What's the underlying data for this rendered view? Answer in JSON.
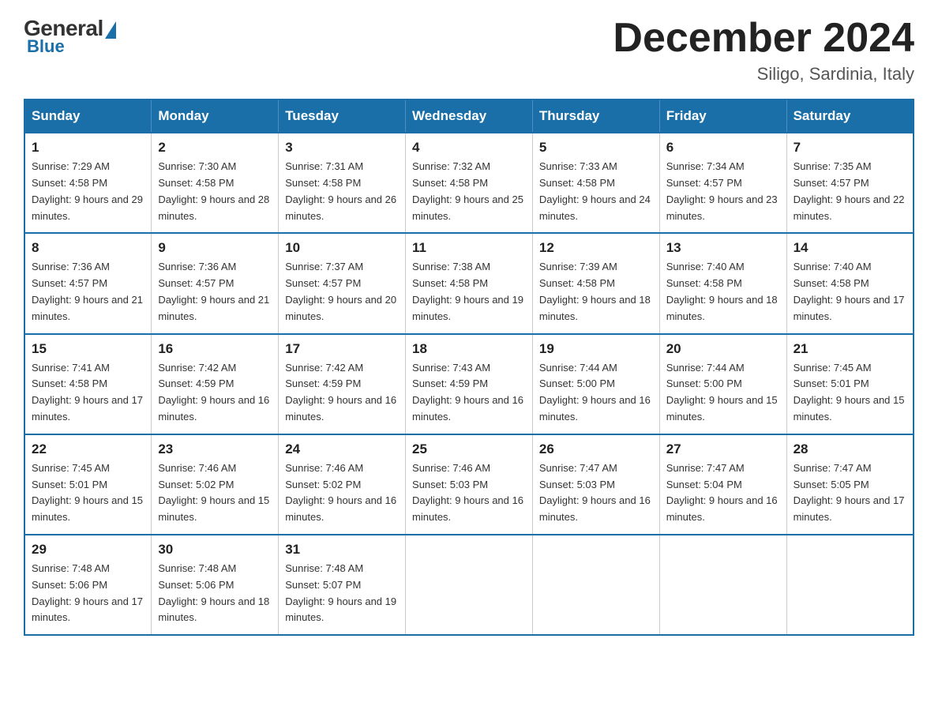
{
  "logo": {
    "general": "General",
    "blue": "Blue"
  },
  "header": {
    "month": "December 2024",
    "location": "Siligo, Sardinia, Italy"
  },
  "weekdays": [
    "Sunday",
    "Monday",
    "Tuesday",
    "Wednesday",
    "Thursday",
    "Friday",
    "Saturday"
  ],
  "weeks": [
    [
      {
        "day": "1",
        "sunrise": "7:29 AM",
        "sunset": "4:58 PM",
        "daylight": "9 hours and 29 minutes."
      },
      {
        "day": "2",
        "sunrise": "7:30 AM",
        "sunset": "4:58 PM",
        "daylight": "9 hours and 28 minutes."
      },
      {
        "day": "3",
        "sunrise": "7:31 AM",
        "sunset": "4:58 PM",
        "daylight": "9 hours and 26 minutes."
      },
      {
        "day": "4",
        "sunrise": "7:32 AM",
        "sunset": "4:58 PM",
        "daylight": "9 hours and 25 minutes."
      },
      {
        "day": "5",
        "sunrise": "7:33 AM",
        "sunset": "4:58 PM",
        "daylight": "9 hours and 24 minutes."
      },
      {
        "day": "6",
        "sunrise": "7:34 AM",
        "sunset": "4:57 PM",
        "daylight": "9 hours and 23 minutes."
      },
      {
        "day": "7",
        "sunrise": "7:35 AM",
        "sunset": "4:57 PM",
        "daylight": "9 hours and 22 minutes."
      }
    ],
    [
      {
        "day": "8",
        "sunrise": "7:36 AM",
        "sunset": "4:57 PM",
        "daylight": "9 hours and 21 minutes."
      },
      {
        "day": "9",
        "sunrise": "7:36 AM",
        "sunset": "4:57 PM",
        "daylight": "9 hours and 21 minutes."
      },
      {
        "day": "10",
        "sunrise": "7:37 AM",
        "sunset": "4:57 PM",
        "daylight": "9 hours and 20 minutes."
      },
      {
        "day": "11",
        "sunrise": "7:38 AM",
        "sunset": "4:58 PM",
        "daylight": "9 hours and 19 minutes."
      },
      {
        "day": "12",
        "sunrise": "7:39 AM",
        "sunset": "4:58 PM",
        "daylight": "9 hours and 18 minutes."
      },
      {
        "day": "13",
        "sunrise": "7:40 AM",
        "sunset": "4:58 PM",
        "daylight": "9 hours and 18 minutes."
      },
      {
        "day": "14",
        "sunrise": "7:40 AM",
        "sunset": "4:58 PM",
        "daylight": "9 hours and 17 minutes."
      }
    ],
    [
      {
        "day": "15",
        "sunrise": "7:41 AM",
        "sunset": "4:58 PM",
        "daylight": "9 hours and 17 minutes."
      },
      {
        "day": "16",
        "sunrise": "7:42 AM",
        "sunset": "4:59 PM",
        "daylight": "9 hours and 16 minutes."
      },
      {
        "day": "17",
        "sunrise": "7:42 AM",
        "sunset": "4:59 PM",
        "daylight": "9 hours and 16 minutes."
      },
      {
        "day": "18",
        "sunrise": "7:43 AM",
        "sunset": "4:59 PM",
        "daylight": "9 hours and 16 minutes."
      },
      {
        "day": "19",
        "sunrise": "7:44 AM",
        "sunset": "5:00 PM",
        "daylight": "9 hours and 16 minutes."
      },
      {
        "day": "20",
        "sunrise": "7:44 AM",
        "sunset": "5:00 PM",
        "daylight": "9 hours and 15 minutes."
      },
      {
        "day": "21",
        "sunrise": "7:45 AM",
        "sunset": "5:01 PM",
        "daylight": "9 hours and 15 minutes."
      }
    ],
    [
      {
        "day": "22",
        "sunrise": "7:45 AM",
        "sunset": "5:01 PM",
        "daylight": "9 hours and 15 minutes."
      },
      {
        "day": "23",
        "sunrise": "7:46 AM",
        "sunset": "5:02 PM",
        "daylight": "9 hours and 15 minutes."
      },
      {
        "day": "24",
        "sunrise": "7:46 AM",
        "sunset": "5:02 PM",
        "daylight": "9 hours and 16 minutes."
      },
      {
        "day": "25",
        "sunrise": "7:46 AM",
        "sunset": "5:03 PM",
        "daylight": "9 hours and 16 minutes."
      },
      {
        "day": "26",
        "sunrise": "7:47 AM",
        "sunset": "5:03 PM",
        "daylight": "9 hours and 16 minutes."
      },
      {
        "day": "27",
        "sunrise": "7:47 AM",
        "sunset": "5:04 PM",
        "daylight": "9 hours and 16 minutes."
      },
      {
        "day": "28",
        "sunrise": "7:47 AM",
        "sunset": "5:05 PM",
        "daylight": "9 hours and 17 minutes."
      }
    ],
    [
      {
        "day": "29",
        "sunrise": "7:48 AM",
        "sunset": "5:06 PM",
        "daylight": "9 hours and 17 minutes."
      },
      {
        "day": "30",
        "sunrise": "7:48 AM",
        "sunset": "5:06 PM",
        "daylight": "9 hours and 18 minutes."
      },
      {
        "day": "31",
        "sunrise": "7:48 AM",
        "sunset": "5:07 PM",
        "daylight": "9 hours and 19 minutes."
      },
      null,
      null,
      null,
      null
    ]
  ],
  "labels": {
    "sunrise": "Sunrise:",
    "sunset": "Sunset:",
    "daylight": "Daylight:"
  }
}
